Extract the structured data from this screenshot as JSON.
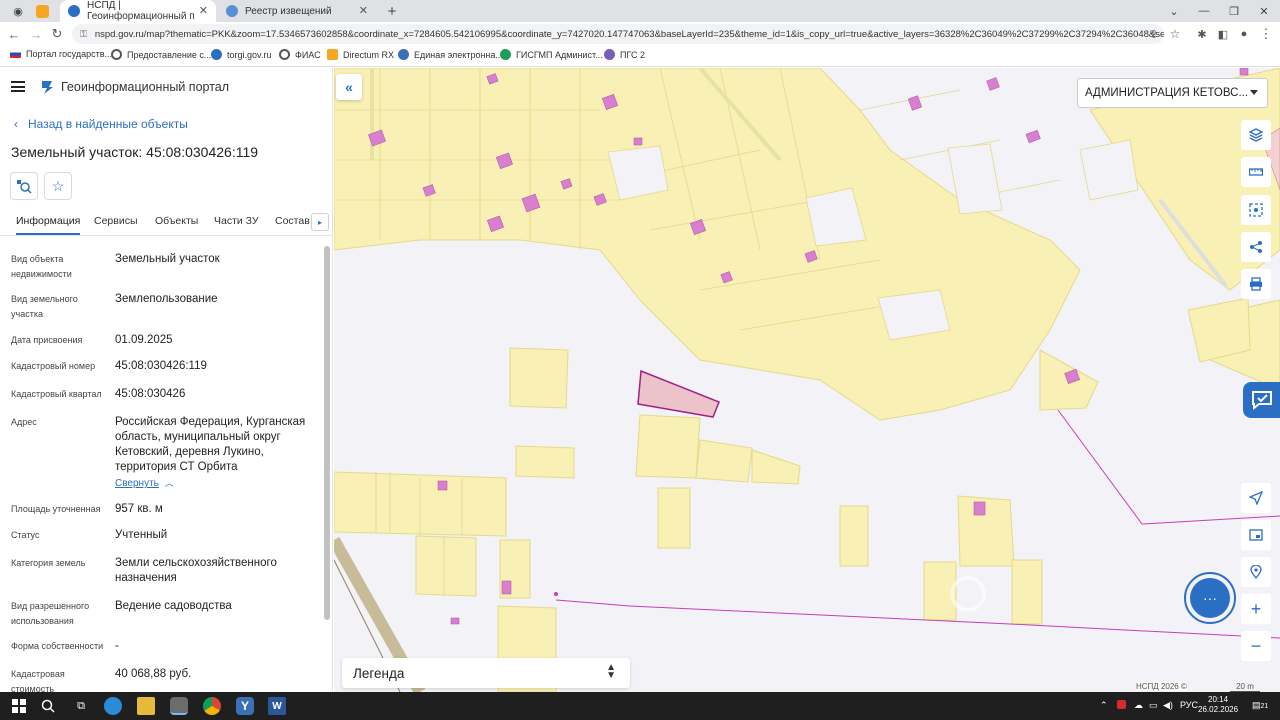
{
  "browser": {
    "tabs": [
      {
        "title": "НСПД | Геоинформационный п",
        "favicon": "nspd-icon"
      },
      {
        "title": "Реестр извещений",
        "favicon": "registry-icon"
      }
    ],
    "url": "nspd.gov.ru/map?thematic=PKK&zoom=17.5346573602858&coordinate_x=7284605.542106995&coordinate_y=7427020.147747063&baseLayerId=235&theme_id=1&is_copy_url=true&active_layers=36328%2C36049%2C37299%2C37294%2C36048&sel...",
    "bookmarks": [
      "Портал государств...",
      "Предоставление с...",
      "torgi.gov.ru",
      "ФИАС",
      "Directum RX",
      "Единая электронна...",
      "ГИСГМП Админист...",
      "ПГС 2"
    ]
  },
  "sidebar": {
    "portal_title": "Геоинформационный портал",
    "back_link": "Назад в найденные объекты",
    "parcel_title": "Земельный участок: 45:08:030426:119",
    "tabs": [
      "Информация",
      "Сервисы",
      "Объекты",
      "Части ЗУ",
      "Состав"
    ],
    "properties": [
      {
        "label": "Вид объекта недвижимости",
        "value": "Земельный участок"
      },
      {
        "label": "Вид земельного участка",
        "value": "Землепользование"
      },
      {
        "label": "Дата присвоения",
        "value": "01.09.2025"
      },
      {
        "label": "Кадастровый номер",
        "value": "45:08:030426:119"
      },
      {
        "label": "Кадастровый квартал",
        "value": "45:08:030426"
      },
      {
        "label": "Адрес",
        "value": "Российская Федерация, Курганская область, муниципальный округ Кетовский, деревня Лукино, территория СТ Орбита"
      },
      {
        "label": "Площадь уточненная",
        "value": "957 кв. м"
      },
      {
        "label": "Статус",
        "value": "Учтенный"
      },
      {
        "label": "Категория земель",
        "value": "Земли сельскохозяйственного назначения"
      },
      {
        "label": "Вид разрешенного использования",
        "value": "Ведение садоводства"
      },
      {
        "label": "Форма собственности",
        "value": "-"
      },
      {
        "label": "Кадастровая стоимость",
        "value": "40 068,88 руб."
      }
    ],
    "collapse_link": "Свернуть"
  },
  "map": {
    "admin_select": "АДМИНИСТРАЦИЯ КЕТОВС...",
    "legend": "Легенда",
    "copyright": "НСПД 2026 ©",
    "scale": "20 m"
  },
  "taskbar": {
    "lang": "РУС",
    "time": "20:14",
    "date": "26.02.2026",
    "notifications": "21"
  },
  "colors": {
    "accent": "#2a6fc4",
    "parcel_fill": "#f8f0b4",
    "building": "#d97fd0",
    "selected": "#a0208a"
  }
}
